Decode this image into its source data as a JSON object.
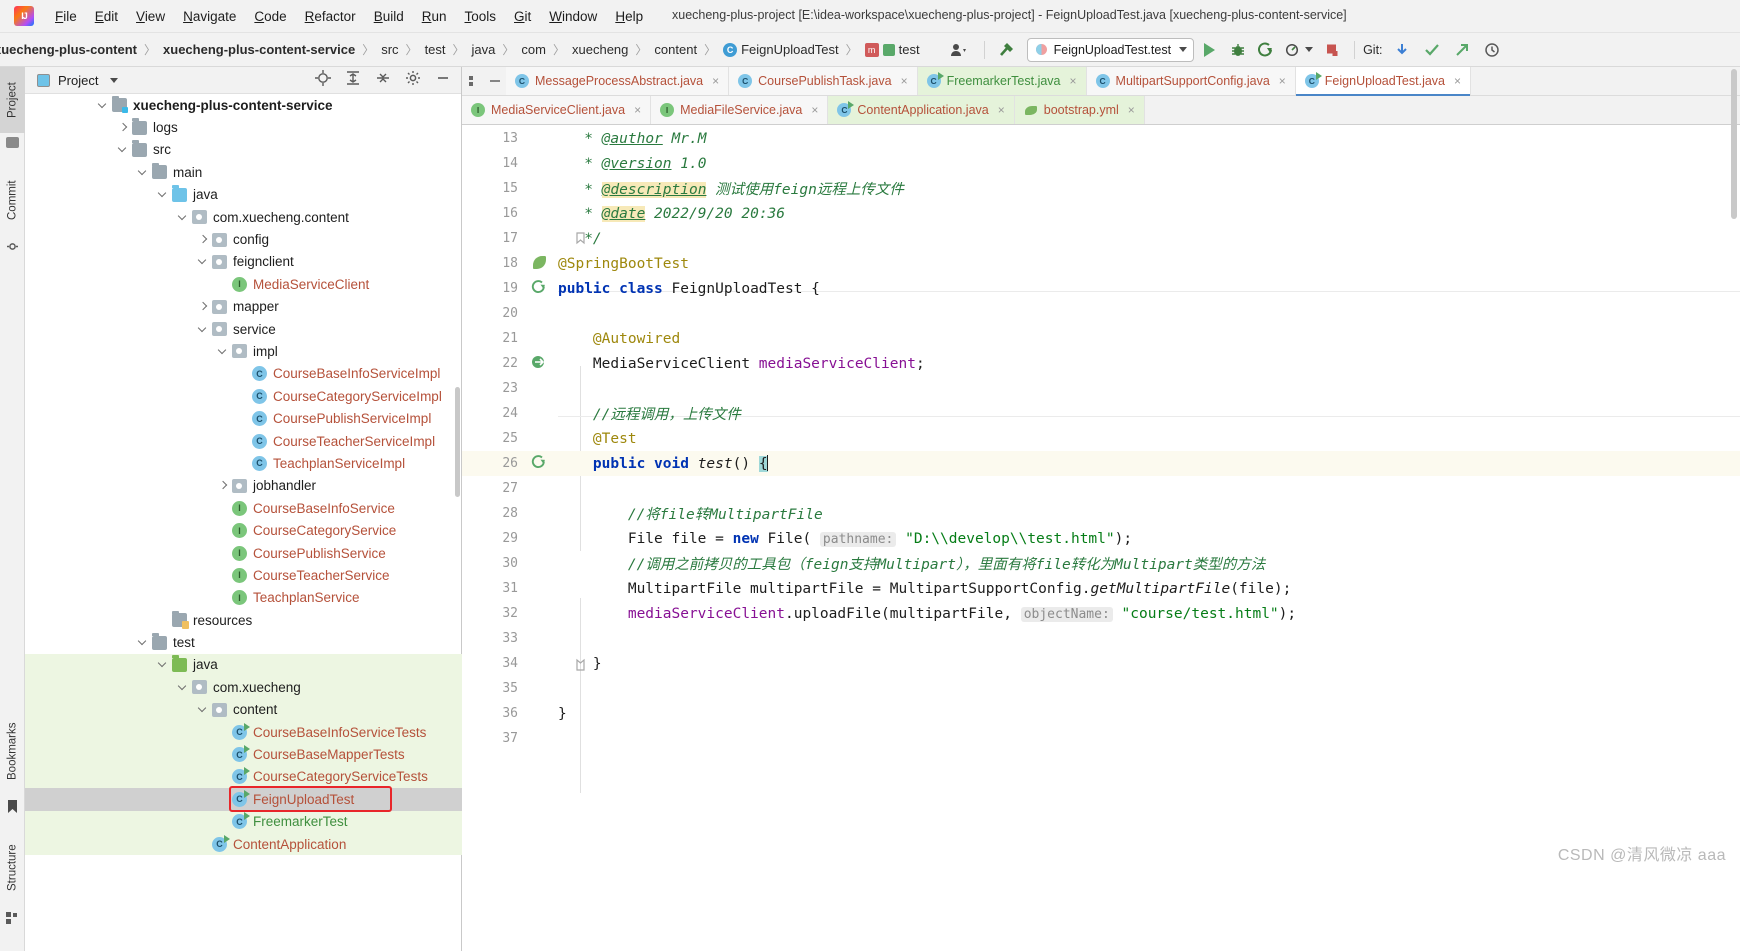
{
  "window": {
    "title": "xuecheng-plus-project [E:\\idea-workspace\\xuecheng-plus-project] - FeignUploadTest.java [xuecheng-plus-content-service]",
    "logo": "intellij-idea-logo"
  },
  "menubar": {
    "items": [
      "File",
      "Edit",
      "View",
      "Navigate",
      "Code",
      "Refactor",
      "Build",
      "Run",
      "Tools",
      "Git",
      "Window",
      "Help"
    ]
  },
  "navbar": {
    "breadcrumbs": [
      {
        "label": "xuecheng-plus-content",
        "bold": true,
        "icon": ""
      },
      {
        "label": "xuecheng-plus-content-service",
        "bold": true,
        "icon": ""
      },
      {
        "label": "src",
        "bold": false,
        "icon": ""
      },
      {
        "label": "test",
        "bold": false,
        "icon": ""
      },
      {
        "label": "java",
        "bold": false,
        "icon": ""
      },
      {
        "label": "com",
        "bold": false,
        "icon": ""
      },
      {
        "label": "xuecheng",
        "bold": false,
        "icon": ""
      },
      {
        "label": "content",
        "bold": false,
        "icon": ""
      },
      {
        "label": "FeignUploadTest",
        "bold": false,
        "icon": "class-icon"
      },
      {
        "label": "test",
        "bold": false,
        "icon": "method-test-icon"
      }
    ],
    "run_config": "FeignUploadTest.test",
    "git_label": "Git:",
    "icons": [
      "user-avatar-icon",
      "hammer-build-icon",
      "run-icon",
      "debug-icon",
      "run-coverage-icon",
      "profiler-icon",
      "stop-icon",
      "git-update-icon",
      "git-commit-icon",
      "git-push-icon",
      "history-icon"
    ]
  },
  "left_strip": {
    "tabs": [
      {
        "label": "Project",
        "selected": true
      },
      {
        "label": "Commit",
        "selected": false
      },
      {
        "label": "Bookmarks",
        "selected": false
      },
      {
        "label": "Structure",
        "selected": false
      }
    ]
  },
  "project_panel": {
    "title": "Project",
    "toolbar_icons": [
      "locate-icon",
      "expand-all-icon",
      "collapse-all-icon",
      "settings-gear-icon",
      "hide-icon"
    ],
    "tree": [
      {
        "depth": 1,
        "arrow": "down",
        "icon": "module-folder",
        "label": "xuecheng-plus-content-service",
        "style": "dark bold",
        "bg": ""
      },
      {
        "depth": 2,
        "arrow": "right",
        "icon": "folder",
        "label": "logs",
        "style": "dark",
        "bg": ""
      },
      {
        "depth": 2,
        "arrow": "down",
        "icon": "folder",
        "label": "src",
        "style": "dark",
        "bg": ""
      },
      {
        "depth": 3,
        "arrow": "down",
        "icon": "folder",
        "label": "main",
        "style": "dark",
        "bg": ""
      },
      {
        "depth": 4,
        "arrow": "down",
        "icon": "source-folder",
        "label": "java",
        "style": "dark",
        "bg": ""
      },
      {
        "depth": 5,
        "arrow": "down",
        "icon": "package",
        "label": "com.xuecheng.content",
        "style": "dark",
        "bg": ""
      },
      {
        "depth": 6,
        "arrow": "right",
        "icon": "package",
        "label": "config",
        "style": "dark",
        "bg": ""
      },
      {
        "depth": 6,
        "arrow": "down",
        "icon": "package",
        "label": "feignclient",
        "style": "dark",
        "bg": ""
      },
      {
        "depth": 7,
        "arrow": "none",
        "icon": "interface",
        "label": "MediaServiceClient",
        "style": "orange",
        "bg": ""
      },
      {
        "depth": 6,
        "arrow": "right",
        "icon": "package",
        "label": "mapper",
        "style": "dark",
        "bg": ""
      },
      {
        "depth": 6,
        "arrow": "down",
        "icon": "package",
        "label": "service",
        "style": "dark",
        "bg": ""
      },
      {
        "depth": 7,
        "arrow": "down",
        "icon": "package",
        "label": "impl",
        "style": "dark",
        "bg": ""
      },
      {
        "depth": 8,
        "arrow": "none",
        "icon": "class",
        "label": "CourseBaseInfoServiceImpl",
        "style": "orange",
        "bg": ""
      },
      {
        "depth": 8,
        "arrow": "none",
        "icon": "class",
        "label": "CourseCategoryServiceImpl",
        "style": "orange",
        "bg": ""
      },
      {
        "depth": 8,
        "arrow": "none",
        "icon": "class",
        "label": "CoursePublishServiceImpl",
        "style": "orange",
        "bg": ""
      },
      {
        "depth": 8,
        "arrow": "none",
        "icon": "class",
        "label": "CourseTeacherServiceImpl",
        "style": "orange",
        "bg": ""
      },
      {
        "depth": 8,
        "arrow": "none",
        "icon": "class",
        "label": "TeachplanServiceImpl",
        "style": "orange",
        "bg": ""
      },
      {
        "depth": 7,
        "arrow": "right",
        "icon": "package",
        "label": "jobhandler",
        "style": "dark",
        "bg": ""
      },
      {
        "depth": 7,
        "arrow": "none",
        "icon": "interface",
        "label": "CourseBaseInfoService",
        "style": "orange",
        "bg": ""
      },
      {
        "depth": 7,
        "arrow": "none",
        "icon": "interface",
        "label": "CourseCategoryService",
        "style": "orange",
        "bg": ""
      },
      {
        "depth": 7,
        "arrow": "none",
        "icon": "interface",
        "label": "CoursePublishService",
        "style": "orange",
        "bg": ""
      },
      {
        "depth": 7,
        "arrow": "none",
        "icon": "interface",
        "label": "CourseTeacherService",
        "style": "orange",
        "bg": ""
      },
      {
        "depth": 7,
        "arrow": "none",
        "icon": "interface",
        "label": "TeachplanService",
        "style": "orange",
        "bg": ""
      },
      {
        "depth": 4,
        "arrow": "none",
        "icon": "resource-folder",
        "label": "resources",
        "style": "dark",
        "bg": ""
      },
      {
        "depth": 3,
        "arrow": "down",
        "icon": "folder",
        "label": "test",
        "style": "dark",
        "bg": ""
      },
      {
        "depth": 4,
        "arrow": "down",
        "icon": "test-source-folder",
        "label": "java",
        "style": "dark",
        "bg": "green"
      },
      {
        "depth": 5,
        "arrow": "down",
        "icon": "package",
        "label": "com.xuecheng",
        "style": "dark",
        "bg": "green"
      },
      {
        "depth": 6,
        "arrow": "down",
        "icon": "package",
        "label": "content",
        "style": "dark",
        "bg": "green"
      },
      {
        "depth": 7,
        "arrow": "none",
        "icon": "test-class",
        "label": "CourseBaseInfoServiceTests",
        "style": "orange",
        "bg": "green"
      },
      {
        "depth": 7,
        "arrow": "none",
        "icon": "test-class",
        "label": "CourseBaseMapperTests",
        "style": "orange",
        "bg": "green"
      },
      {
        "depth": 7,
        "arrow": "none",
        "icon": "test-class",
        "label": "CourseCategoryServiceTests",
        "style": "orange",
        "bg": "green"
      },
      {
        "depth": 7,
        "arrow": "none",
        "icon": "test-class",
        "label": "FeignUploadTest",
        "style": "orange",
        "bg": "selected"
      },
      {
        "depth": 7,
        "arrow": "none",
        "icon": "test-class",
        "label": "FreemarkerTest",
        "style": "green",
        "bg": "green"
      },
      {
        "depth": 6,
        "arrow": "none",
        "icon": "spring-class",
        "label": "ContentApplication",
        "style": "orange",
        "bg": "green"
      }
    ],
    "selected_item": "FeignUploadTest",
    "highlight_box_item": "FeignUploadTest"
  },
  "editor": {
    "tabs_row1": [
      {
        "label": "MessageProcessAbstract.java",
        "icon": "class-icon",
        "state": "normal",
        "color": "orange"
      },
      {
        "label": "CoursePublishTask.java",
        "icon": "class-icon",
        "state": "normal",
        "color": "orange"
      },
      {
        "label": "FreemarkerTest.java",
        "icon": "test-class-icon",
        "state": "green",
        "color": "green"
      },
      {
        "label": "MultipartSupportConfig.java",
        "icon": "class-icon",
        "state": "normal",
        "color": "orange"
      },
      {
        "label": "FeignUploadTest.java",
        "icon": "test-class-icon",
        "state": "active",
        "color": "orange"
      }
    ],
    "tabs_row2": [
      {
        "label": "MediaServiceClient.java",
        "icon": "interface-icon",
        "state": "normal",
        "color": "orange"
      },
      {
        "label": "MediaFileService.java",
        "icon": "interface-icon",
        "state": "normal",
        "color": "orange"
      },
      {
        "label": "ContentApplication.java",
        "icon": "spring-class-icon",
        "state": "green",
        "color": "orange"
      },
      {
        "label": "bootstrap.yml",
        "icon": "yaml-icon",
        "state": "green",
        "color": "orange"
      }
    ],
    "close_glyph": "×",
    "lines": [
      {
        "num": "13",
        "mark": "",
        "html": "   <span class=\"cm\">* </span><span class=\"cmu\">@author</span><span class=\"cm\"> Mr.M</span>"
      },
      {
        "num": "14",
        "mark": "",
        "html": "   <span class=\"cm\">* </span><span class=\"cmu\">@version</span><span class=\"cm\"> 1.0</span>"
      },
      {
        "num": "15",
        "mark": "",
        "html": "   <span class=\"cm\">* </span><span class=\"cmu hl-tag\">@description</span><span class=\"cm\"> 测试使用feign远程上传文件</span>"
      },
      {
        "num": "16",
        "mark": "",
        "html": "   <span class=\"cm\">* </span><span class=\"cmu hl-tag\">@date</span><span class=\"cm\"> 2022/9/20 20:36</span>"
      },
      {
        "num": "17",
        "mark": "fold",
        "html": "   <span class=\"cm\">*/</span>"
      },
      {
        "num": "18",
        "mark": "leaf",
        "html": "<span class=\"an\">@SpringBootTest</span>"
      },
      {
        "num": "19",
        "mark": "run",
        "html": "<span class=\"kw\">public class</span> FeignUploadTest {"
      },
      {
        "num": "20",
        "mark": "",
        "html": ""
      },
      {
        "num": "21",
        "mark": "",
        "html": "    <span class=\"an\">@Autowired</span>"
      },
      {
        "num": "22",
        "mark": "impl",
        "html": "    MediaServiceClient <span class=\"fld\">mediaServiceClient</span>;"
      },
      {
        "num": "23",
        "mark": "",
        "html": ""
      },
      {
        "num": "24",
        "mark": "",
        "html": "    <span class=\"cm\">//远程调用，上传文件</span>"
      },
      {
        "num": "25",
        "mark": "",
        "html": "    <span class=\"an\">@Test</span>"
      },
      {
        "num": "26",
        "mark": "run",
        "hl": true,
        "html": "    <span class=\"kw\">public void</span> <span class=\"mth\">test</span>() <span class=\"caretblk\">{</span><span class=\"cursor\"></span>"
      },
      {
        "num": "27",
        "mark": "",
        "html": ""
      },
      {
        "num": "28",
        "mark": "",
        "html": "        <span class=\"cm\">//将file转MultipartFile</span>"
      },
      {
        "num": "29",
        "mark": "",
        "html": "        File file = <span class=\"kw\">new</span> File( <span class=\"hint\">pathname:</span> <span class=\"str\">\"D:\\\\develop\\\\test.html\"</span>);"
      },
      {
        "num": "30",
        "mark": "",
        "html": "        <span class=\"cm\">//调用之前拷贝的工具包（feign支持Multipart），里面有将file转化为Multipart类型的方法</span>"
      },
      {
        "num": "31",
        "mark": "",
        "html": "        MultipartFile multipartFile = MultipartSupportConfig.<span class=\"mth\">getMultipartFile</span>(file);"
      },
      {
        "num": "32",
        "mark": "",
        "html": "        <span class=\"fld\">mediaServiceClient</span>.uploadFile(multipartFile, <span class=\"hint\">objectName:</span> <span class=\"str\">\"course/test.html\"</span>);"
      },
      {
        "num": "33",
        "mark": "",
        "html": ""
      },
      {
        "num": "34",
        "mark": "foldend",
        "html": "    }"
      },
      {
        "num": "35",
        "mark": "",
        "html": ""
      },
      {
        "num": "36",
        "mark": "",
        "html": "}"
      },
      {
        "num": "37",
        "mark": "",
        "html": ""
      }
    ]
  },
  "watermark": "CSDN @清风微凉 aaa",
  "colors": {
    "accent_blue": "#4a86c8",
    "test_green_bg": "#edf6e2",
    "selection_gray": "#d0d0d0",
    "highlight_red": "#e8262a",
    "keyword_blue": "#0033b3",
    "comment_green": "#2a7a3f",
    "string_green": "#067d17",
    "field_purple": "#871094",
    "annotation_gold": "#9e880d",
    "tree_orange": "#b5513a"
  }
}
